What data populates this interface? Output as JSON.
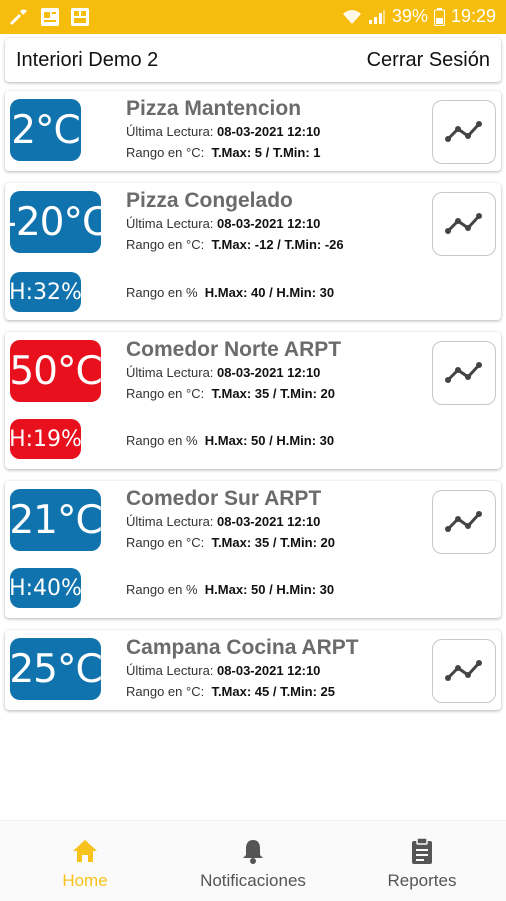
{
  "status_bar": {
    "battery": "39%",
    "time": "19:29"
  },
  "header": {
    "title": "Interiori Demo 2",
    "logout_label": "Cerrar Sesión"
  },
  "sensors": [
    {
      "temp": "2°C",
      "name": "Pizza Mantencion",
      "reading_label": "Última Lectura:",
      "reading_value": "08-03-2021 12:10",
      "range_label": "Rango en °C:",
      "range_value": "T.Max: 5 / T.Min: 1",
      "status": "ok"
    },
    {
      "temp": "-20°C",
      "name": "Pizza Congelado",
      "reading_label": "Última Lectura:",
      "reading_value": "08-03-2021 12:10",
      "range_label": "Rango en °C:",
      "range_value": "T.Max: -12 / T.Min: -26",
      "humidity": "H:32%",
      "hum_range_label": "Rango en %",
      "hum_range_value": "H.Max: 40 / H.Min: 30",
      "status": "ok"
    },
    {
      "temp": "50°C",
      "name": "Comedor Norte ARPT",
      "reading_label": "Última Lectura:",
      "reading_value": "08-03-2021 12:10",
      "range_label": "Rango en °C:",
      "range_value": "T.Max: 35 / T.Min: 20",
      "humidity": "H:19%",
      "hum_range_label": "Rango en %",
      "hum_range_value": "H.Max: 50 / H.Min: 30",
      "status": "alert"
    },
    {
      "temp": "21°C",
      "name": "Comedor Sur ARPT",
      "reading_label": "Última Lectura:",
      "reading_value": "08-03-2021 12:10",
      "range_label": "Rango en °C:",
      "range_value": "T.Max: 35 / T.Min: 20",
      "humidity": "H:40%",
      "hum_range_label": "Rango en %",
      "hum_range_value": "H.Max: 50 / H.Min: 30",
      "status": "ok"
    },
    {
      "temp": "25°C",
      "name": "Campana Cocina ARPT",
      "reading_label": "Última Lectura:",
      "reading_value": "08-03-2021 12:10",
      "range_label": "Rango en °C:",
      "range_value": "T.Max: 45 / T.Min: 25",
      "status": "ok"
    }
  ],
  "colors": {
    "ok": "#1073ad",
    "alert": "#e8101c",
    "accent": "#f7bd0d"
  },
  "nav": {
    "home": "Home",
    "notifications": "Notificaciones",
    "reports": "Reportes"
  }
}
